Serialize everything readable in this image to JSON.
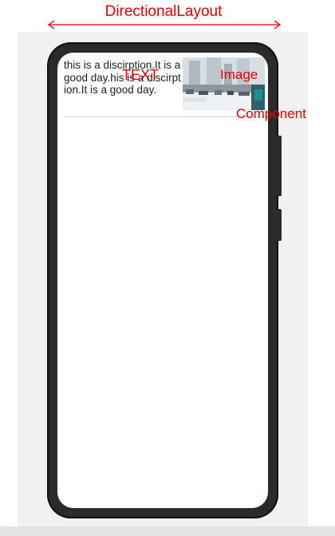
{
  "labels": {
    "layout": "DirectionalLayout",
    "text": "TEXT",
    "image": "Image",
    "component": "Component"
  },
  "list_item": {
    "description": "this is a discirption.It is a good day.his is a discirption.It is a good day."
  },
  "colors": {
    "annotation": "#e60000",
    "phone_frame": "#2a2a2a",
    "panel_background": "#f1f1f1"
  }
}
